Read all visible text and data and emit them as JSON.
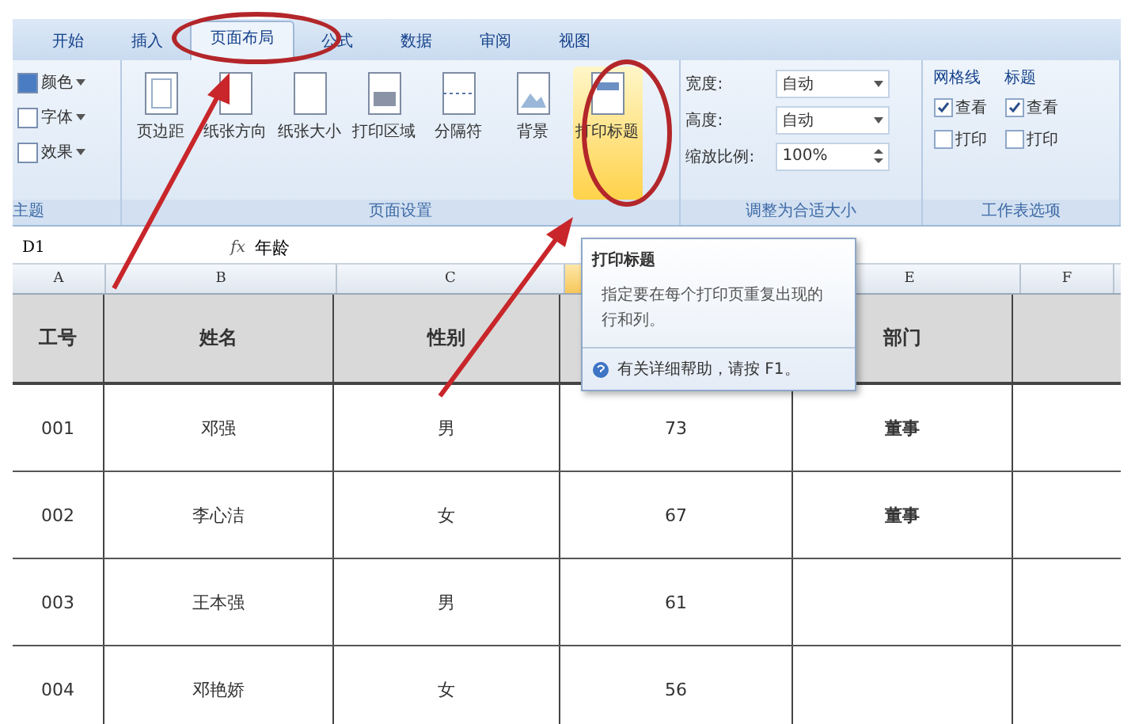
{
  "tabs": [
    {
      "label": "开始",
      "selected": false
    },
    {
      "label": "插入",
      "selected": false
    },
    {
      "label": "页面布局",
      "selected": true
    },
    {
      "label": "公式",
      "selected": false
    },
    {
      "label": "数据",
      "selected": false
    },
    {
      "label": "审阅",
      "selected": false
    },
    {
      "label": "视图",
      "selected": false
    }
  ],
  "ribbon": {
    "theme_group": {
      "label": "主题",
      "items": [
        "颜色",
        "字体",
        "效果"
      ]
    },
    "page_setup": {
      "label": "页面设置",
      "buttons": [
        {
          "label": "页边距",
          "highlighted": false
        },
        {
          "label": "纸张方向",
          "highlighted": false
        },
        {
          "label": "纸张大小",
          "highlighted": false
        },
        {
          "label": "打印区域",
          "highlighted": false
        },
        {
          "label": "分隔符",
          "highlighted": false
        },
        {
          "label": "背景",
          "highlighted": false
        },
        {
          "label": "打印标题",
          "highlighted": true
        }
      ]
    },
    "scale_to_fit": {
      "label": "调整为合适大小",
      "rows": [
        {
          "label": "宽度:",
          "value": "自动",
          "kind": "dropdown"
        },
        {
          "label": "高度:",
          "value": "自动",
          "kind": "dropdown"
        },
        {
          "label": "缩放比例:",
          "value": "100%",
          "kind": "spinner"
        }
      ]
    },
    "sheet_options": {
      "label": "工作表选项",
      "columns": [
        {
          "title": "网格线",
          "view": {
            "label": "查看",
            "checked": true
          },
          "print": {
            "label": "打印",
            "checked": false
          }
        },
        {
          "title": "标题",
          "view": {
            "label": "查看",
            "checked": true
          },
          "print": {
            "label": "打印",
            "checked": false
          }
        }
      ]
    }
  },
  "formula_bar": {
    "name_box": "D1",
    "fx": "fx",
    "value": "年龄"
  },
  "column_headers": [
    {
      "letter": "A",
      "selected": false
    },
    {
      "letter": "B",
      "selected": false
    },
    {
      "letter": "C",
      "selected": false
    },
    {
      "selected": true
    },
    {
      "letter": "E",
      "selected": false
    },
    {
      "letter": "F",
      "selected": false
    }
  ],
  "table": {
    "header": [
      "工号",
      "姓名",
      "性别"
    ],
    "header_after_tooltip": [
      "部门"
    ],
    "rows": [
      {
        "cells": [
          "001",
          "邓强",
          "男",
          "73",
          "董事"
        ]
      },
      {
        "cells": [
          "002",
          "李心洁",
          "女",
          "67",
          "董事"
        ]
      },
      {
        "cells": [
          "003",
          "王本强",
          "男",
          "61"
        ]
      },
      {
        "cells": [
          "004",
          "邓艳娇",
          "女",
          "56"
        ]
      }
    ]
  },
  "tooltip": {
    "title": "打印标题",
    "body": "指定要在每个打印页重复出现的行和列。",
    "help": "有关详细帮助，请按 F1。"
  }
}
